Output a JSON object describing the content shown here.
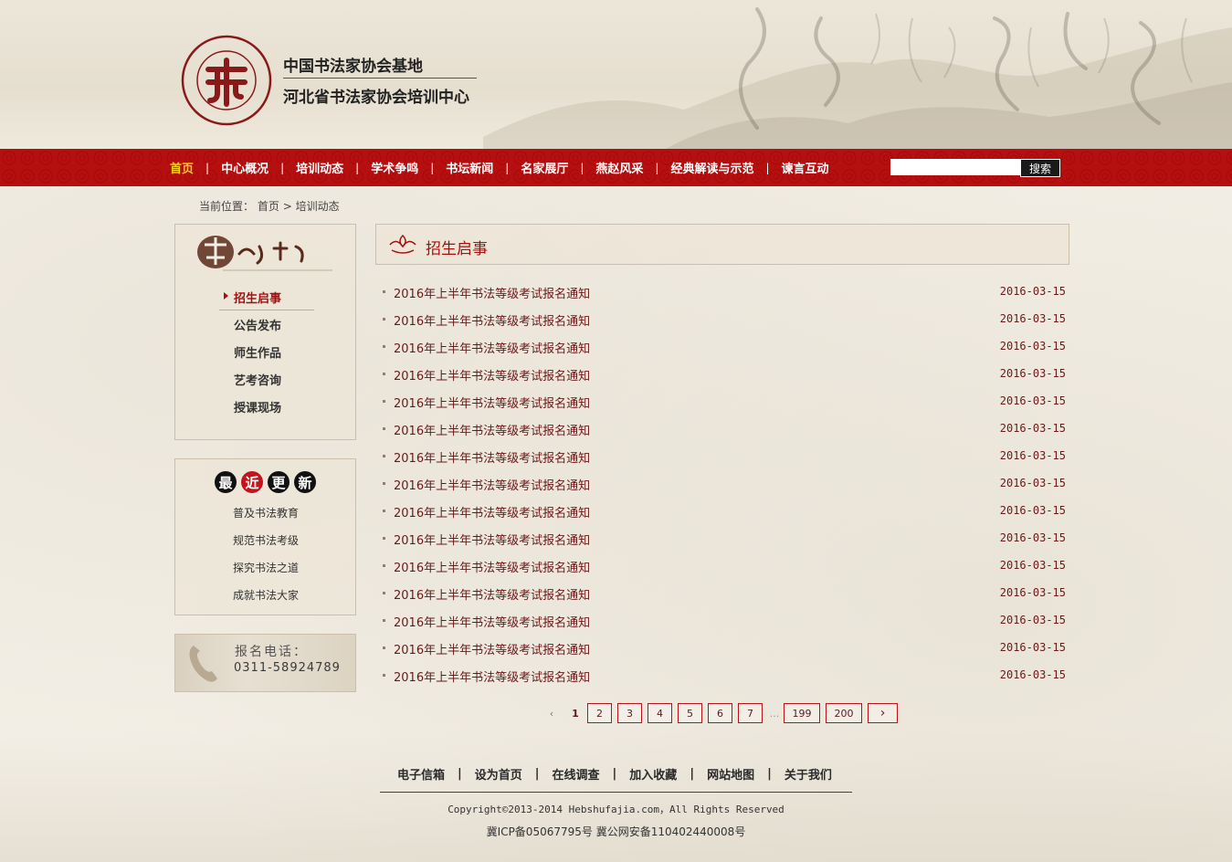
{
  "header": {
    "logo_line1": "中国书法家协会基地",
    "logo_line2": "河北省书法家协会培训中心"
  },
  "nav": {
    "items": [
      {
        "label": "首页"
      },
      {
        "label": "中心概况"
      },
      {
        "label": "培训动态"
      },
      {
        "label": "学术争鸣"
      },
      {
        "label": "书坛新闻"
      },
      {
        "label": "名家展厅"
      },
      {
        "label": "燕赵风采"
      },
      {
        "label": "经典解读与示范"
      },
      {
        "label": "谏言互动"
      }
    ],
    "separator": "|",
    "search_button": "搜索",
    "search_value": ""
  },
  "breadcrumb": {
    "prefix": "当前位置：",
    "home": "首页",
    "sep": ">",
    "current": "培训动态"
  },
  "sidebar": {
    "menu": [
      {
        "label": "招生启事"
      },
      {
        "label": "公告发布"
      },
      {
        "label": "师生作品"
      },
      {
        "label": "艺考咨询"
      },
      {
        "label": "授课现场"
      }
    ],
    "recent_title": [
      "最",
      "近",
      "更",
      "新"
    ],
    "recent": [
      {
        "label": "普及书法教育"
      },
      {
        "label": "规范书法考级"
      },
      {
        "label": "探究书法之道"
      },
      {
        "label": "成就书法大家"
      }
    ],
    "phone_label": "报名电话：",
    "phone_number": "0311-58924789"
  },
  "main": {
    "title": "招生启事",
    "items": [
      {
        "title": "2016年上半年书法等级考试报名通知",
        "date": "2016-03-15"
      },
      {
        "title": "2016年上半年书法等级考试报名通知",
        "date": "2016-03-15"
      },
      {
        "title": "2016年上半年书法等级考试报名通知",
        "date": "2016-03-15"
      },
      {
        "title": "2016年上半年书法等级考试报名通知",
        "date": "2016-03-15"
      },
      {
        "title": "2016年上半年书法等级考试报名通知",
        "date": "2016-03-15"
      },
      {
        "title": "2016年上半年书法等级考试报名通知",
        "date": "2016-03-15"
      },
      {
        "title": "2016年上半年书法等级考试报名通知",
        "date": "2016-03-15"
      },
      {
        "title": "2016年上半年书法等级考试报名通知",
        "date": "2016-03-15"
      },
      {
        "title": "2016年上半年书法等级考试报名通知",
        "date": "2016-03-15"
      },
      {
        "title": "2016年上半年书法等级考试报名通知",
        "date": "2016-03-15"
      },
      {
        "title": "2016年上半年书法等级考试报名通知",
        "date": "2016-03-15"
      },
      {
        "title": "2016年上半年书法等级考试报名通知",
        "date": "2016-03-15"
      },
      {
        "title": "2016年上半年书法等级考试报名通知",
        "date": "2016-03-15"
      },
      {
        "title": "2016年上半年书法等级考试报名通知",
        "date": "2016-03-15"
      },
      {
        "title": "2016年上半年书法等级考试报名通知",
        "date": "2016-03-15"
      }
    ]
  },
  "pagination": {
    "prev": "‹",
    "next": "›",
    "pages": [
      "1",
      "2",
      "3",
      "4",
      "5",
      "6",
      "7",
      "...",
      "199",
      "200"
    ],
    "current": "1"
  },
  "footer": {
    "links": [
      {
        "label": "电子信箱"
      },
      {
        "label": "设为首页"
      },
      {
        "label": "在线调查"
      },
      {
        "label": "加入收藏"
      },
      {
        "label": "网站地图"
      },
      {
        "label": "关于我们"
      }
    ],
    "separator": "|",
    "copyright": "Copyright©2013-2014 Hebshufajia.com，All Rights Reserved",
    "icp": "冀ICP备05067795号 冀公网安备110402440008号"
  },
  "colors": {
    "brand_red": "#b50f10",
    "nav_active": "#ffd21a",
    "link_dark_red": "#6a1818"
  },
  "icons": {
    "logo": "seal-logo",
    "main_title": "ornament-icon",
    "phone": "phone-handset-icon"
  }
}
